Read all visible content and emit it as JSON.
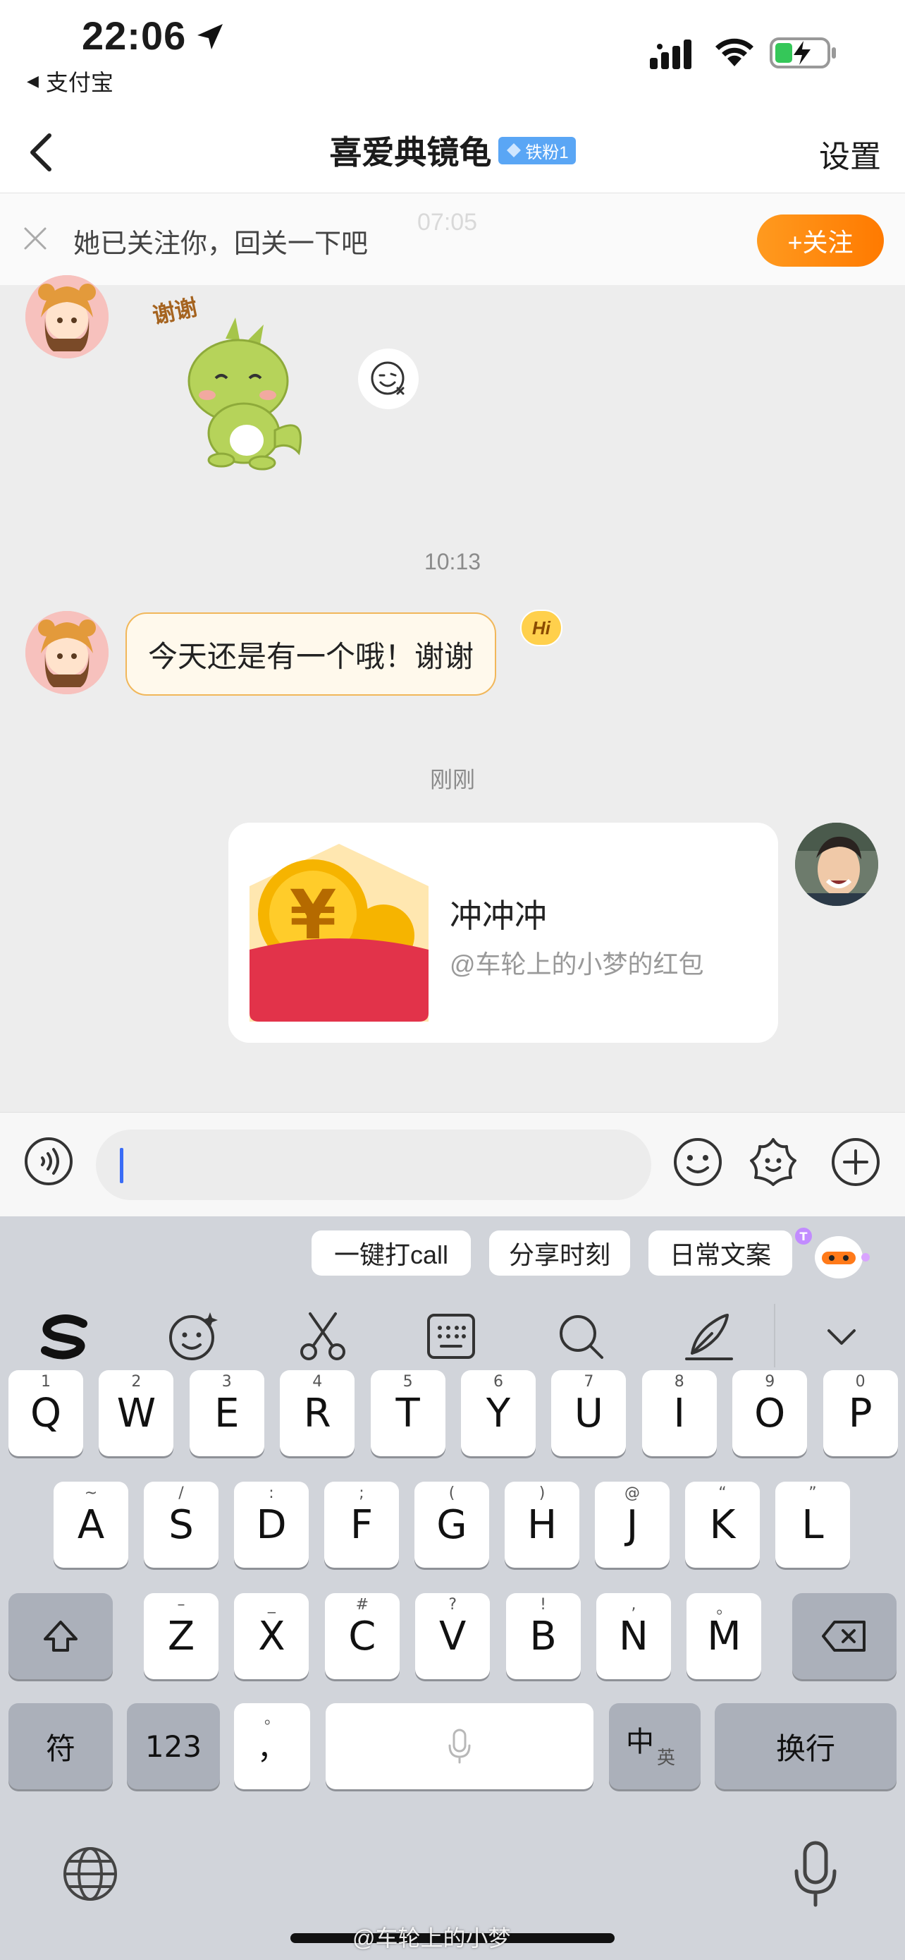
{
  "status_bar": {
    "time": "22:06",
    "back_app": "支付宝"
  },
  "nav": {
    "title": "喜爱典镜龟",
    "fan_badge": "铁粉1",
    "settings": "设置"
  },
  "follow_banner": {
    "text": "她已关注你，回关一下吧",
    "ghost_time": "07:05",
    "follow_button": "+关注"
  },
  "chat": {
    "timestamp_1": "10:13",
    "message_1": "今天还是有一个哦！谢谢",
    "hi_badge": "Hi",
    "timestamp_2": "刚刚",
    "red_packet": {
      "title": "冲冲冲",
      "subtitle": "@车轮上的小梦的红包"
    },
    "sticker_caption": "谢谢"
  },
  "input": {
    "placeholder": ""
  },
  "keyboard": {
    "suggestions": [
      "一键打call",
      "分享时刻",
      "日常文案"
    ],
    "row1": [
      {
        "k": "Q",
        "h": "1"
      },
      {
        "k": "W",
        "h": "2"
      },
      {
        "k": "E",
        "h": "3"
      },
      {
        "k": "R",
        "h": "4"
      },
      {
        "k": "T",
        "h": "5"
      },
      {
        "k": "Y",
        "h": "6"
      },
      {
        "k": "U",
        "h": "7"
      },
      {
        "k": "I",
        "h": "8"
      },
      {
        "k": "O",
        "h": "9"
      },
      {
        "k": "P",
        "h": "0"
      }
    ],
    "row2": [
      {
        "k": "A",
        "h": "~"
      },
      {
        "k": "S",
        "h": "/"
      },
      {
        "k": "D",
        "h": ":"
      },
      {
        "k": "F",
        "h": ";"
      },
      {
        "k": "G",
        "h": "("
      },
      {
        "k": "H",
        "h": ")"
      },
      {
        "k": "J",
        "h": "@"
      },
      {
        "k": "K",
        "h": "“"
      },
      {
        "k": "L",
        "h": "”"
      }
    ],
    "row3": [
      {
        "k": "Z",
        "h": "–"
      },
      {
        "k": "X",
        "h": "_"
      },
      {
        "k": "C",
        "h": "#"
      },
      {
        "k": "V",
        "h": "?"
      },
      {
        "k": "B",
        "h": "!"
      },
      {
        "k": "N",
        "h": ","
      },
      {
        "k": "M",
        "h": "。"
      }
    ],
    "symbols_key": "符",
    "numbers_key": "123",
    "punct_key": "，",
    "punct_hint": "。",
    "lang_key": "中",
    "lang_key_sub": "英",
    "return_key": "换行"
  },
  "watermark": "@车轮上的小梦"
}
